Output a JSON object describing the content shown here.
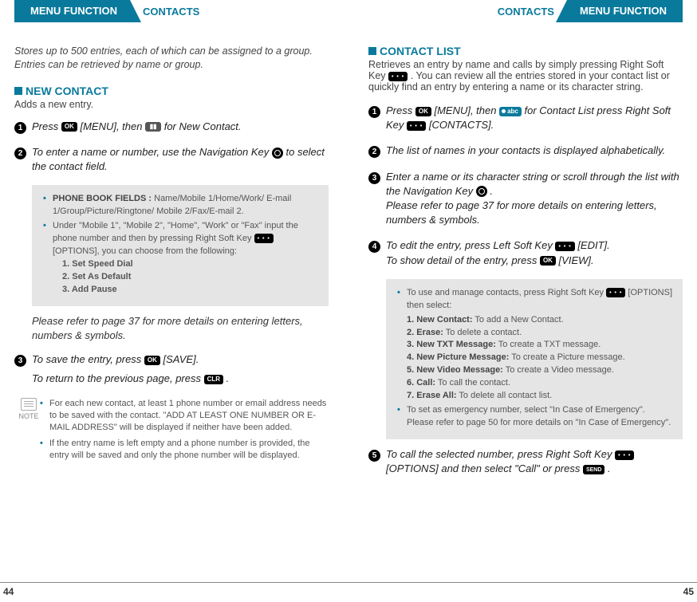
{
  "header": {
    "menu_function": "MENU FUNCTION",
    "contacts": "CONTACTS"
  },
  "left": {
    "intro": "Stores up to 500 entries, each of which can be assigned to a group. Entries can be retrieved by name or group.",
    "new_contact": {
      "title": "NEW CONTACT",
      "desc": "Adds a new entry."
    },
    "steps": {
      "s1a": "Press ",
      "s1b": " [MENU], then ",
      "s1c": " for New Contact.",
      "s2a": "To enter a name or number, use the Navigation Key ",
      "s2b": " to select the contact field.",
      "s3a": "To save the entry, press ",
      "s3b": " [SAVE].",
      "s3c": "To return to the previous page, press ",
      "s3d": " ."
    },
    "box1": {
      "b1_label": "PHONE BOOK FIELDS :",
      "b1_text": " Name/Mobile 1/Home/Work/ E-mail 1/Group/Picture/Ringtone/ Mobile 2/Fax/E-mail 2.",
      "b2a": "Under \"Mobile 1\", \"Mobile 2\", \"Home\", \"Work\" or \"Fax\" input the phone number and then by pressing Right Soft Key ",
      "b2b": " [OPTIONS], you can choose from the following:",
      "opt1": "1. Set Speed Dial",
      "opt2": "2. Set As Default",
      "opt3": "3. Add Pause"
    },
    "ref": "Please refer to page 37 for more details on entering letters, numbers & symbols.",
    "note": {
      "label": "NOTE",
      "n1": "For each new contact, at least 1 phone number or email address needs to be saved with the contact. \"ADD AT LEAST ONE NUMBER OR E-MAIL ADDRESS\" will be displayed if neither have been added.",
      "n2": "If the entry name is left empty and a phone number is provided, the entry will be saved and only the phone number will be displayed."
    },
    "page_num": "44"
  },
  "right": {
    "contact_list": {
      "title": "CONTACT LIST",
      "desc_a": "Retrieves an entry by name and calls by simply pressing Right Soft Key ",
      "desc_b": " . You can review all the entries stored in your contact list or quickly find an entry by entering a name or its character string."
    },
    "steps": {
      "s1a": "Press ",
      "s1b": " [MENU], then ",
      "s1c": " for Contact List press Right Soft Key ",
      "s1d": " [CONTACTS].",
      "s2": "The list of names in your contacts is displayed alphabetically.",
      "s3a": "Enter a name or its character string or scroll through the list with the Navigation Key ",
      "s3b": " .",
      "s3c": "Please refer to page 37 for more details on entering letters, numbers & symbols.",
      "s4a": "To edit the entry, press Left Soft Key ",
      "s4b": " [EDIT].",
      "s4c": "To show detail of the entry, press ",
      "s4d": " [VIEW].",
      "s5a": "To call the selected number, press Right Soft Key ",
      "s5b": " [OPTIONS] and then select \"Call\" or press ",
      "s5c": " ."
    },
    "box": {
      "b1a": "To use and manage contacts, press Right Soft Key ",
      "b1b": " [OPTIONS] then select:",
      "o1l": "1. New Contact:",
      "o1t": " To add a New Contact.",
      "o2l": "2. Erase:",
      "o2t": " To delete a contact.",
      "o3l": "3. New TXT Message:",
      "o3t": " To create a TXT message.",
      "o4l": "4. New Picture Message:",
      "o4t": " To create a Picture message.",
      "o5l": "5. New Video Message:",
      "o5t": " To create a Video message.",
      "o6l": "6. Call:",
      "o6t": " To call the contact.",
      "o7l": "7. Erase All:",
      "o7t": " To delete all contact list.",
      "b2": "To set as emergency number, select \"In Case of Emergency\".  Please refer to page 50 for more details on \"In Case of Emergency\"."
    },
    "page_num": "45"
  }
}
